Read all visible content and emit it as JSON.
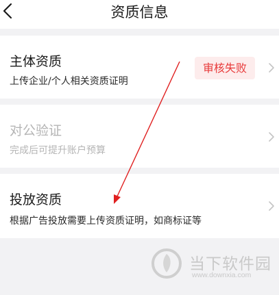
{
  "header": {
    "title": "资质信息",
    "back_icon": "chevron-left-icon"
  },
  "cards": [
    {
      "title": "主体资质",
      "subtitle": "上传企业/个人相关资质证明",
      "status_badge": "审核失败",
      "status_color": "#e83a3a",
      "enabled": true
    },
    {
      "title": "对公验证",
      "subtitle": "完成后可提升账户预算",
      "enabled": false
    },
    {
      "title": "投放资质",
      "subtitle": "根据广告投放需要上传资质证明，如商标证等",
      "enabled": true
    }
  ],
  "watermark": {
    "name": "当下软件园",
    "url": "www.downxia.com"
  },
  "colors": {
    "page_background": "#f2f2f4",
    "card_background": "#ffffff",
    "badge_background": "#fdecec",
    "annotation_arrow": "#e02020"
  }
}
